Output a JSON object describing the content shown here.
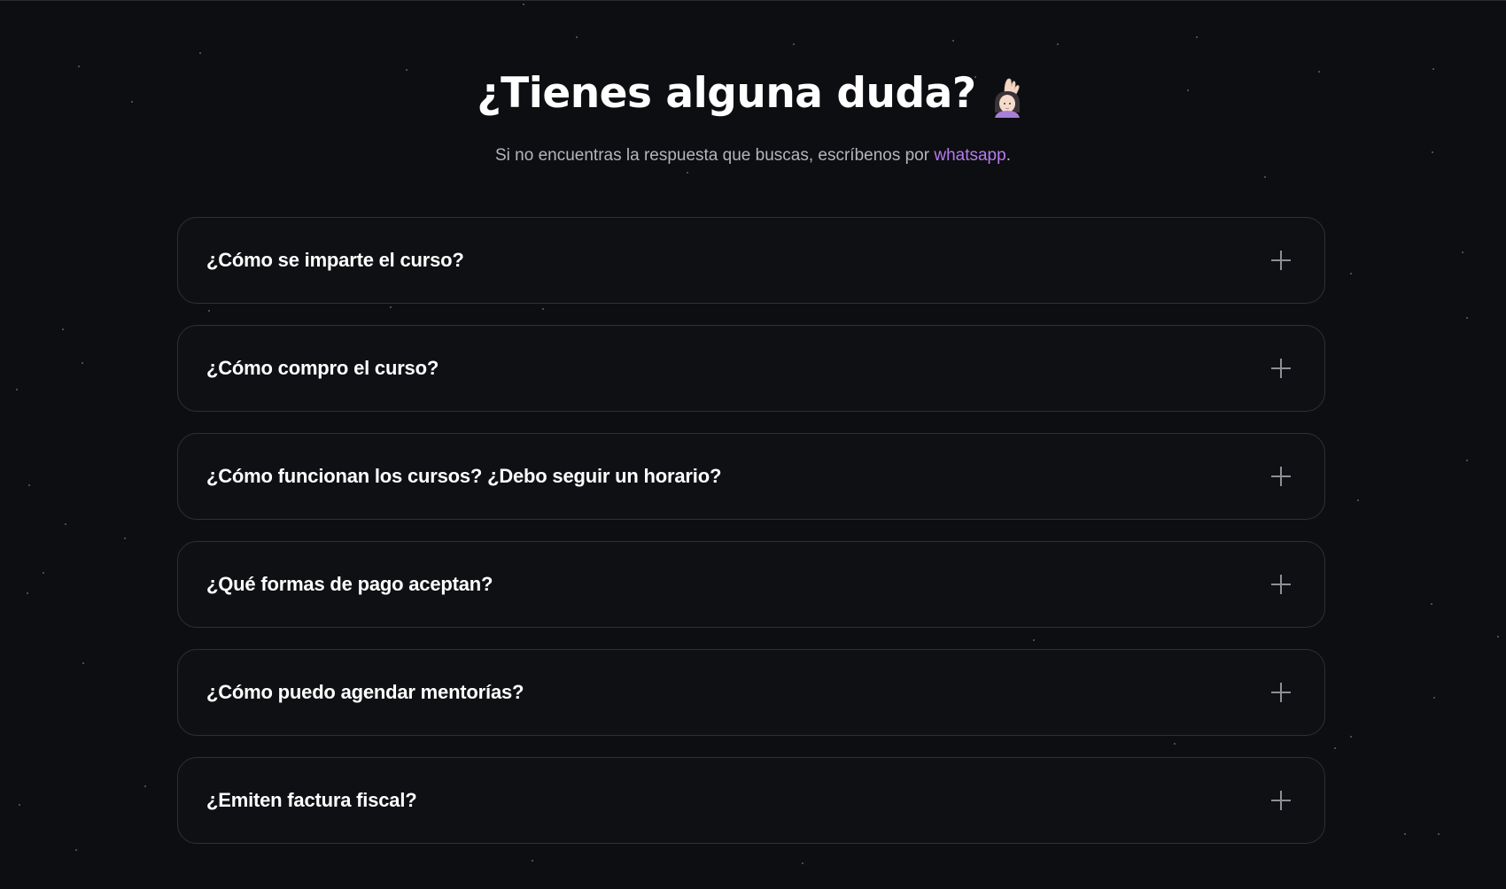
{
  "header": {
    "title": "¿Tienes alguna duda?",
    "title_icon": "raising-hand-woman-emoji-icon",
    "subtitle_prefix": "Si no encuentras la respuesta que buscas, escríbenos por ",
    "subtitle_link": "whatsapp",
    "subtitle_suffix": "."
  },
  "faq": {
    "items": [
      {
        "question": "¿Cómo se imparte el curso?",
        "icon": "plus-icon"
      },
      {
        "question": "¿Cómo compro el curso?",
        "icon": "plus-icon"
      },
      {
        "question": "¿Cómo funcionan los cursos? ¿Debo seguir un horario?",
        "icon": "plus-icon"
      },
      {
        "question": "¿Qué formas de pago aceptan?",
        "icon": "plus-icon"
      },
      {
        "question": "¿Cómo puedo agendar mentorías?",
        "icon": "plus-icon"
      },
      {
        "question": "¿Emiten factura fiscal?",
        "icon": "plus-icon"
      }
    ]
  },
  "colors": {
    "background": "#0d0e11",
    "card_border": "#2f3036",
    "link": "#b57bf0",
    "subtitle": "#b3b5bd",
    "icon": "#8d8f96"
  }
}
